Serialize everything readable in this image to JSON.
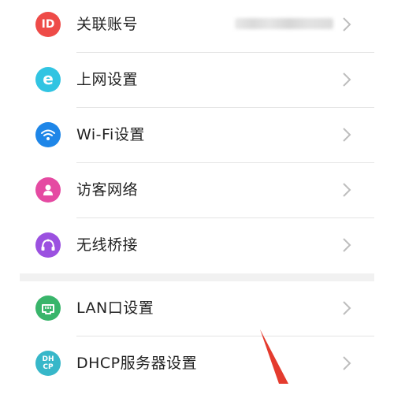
{
  "colors": {
    "account_icon": "#ee4b48",
    "internet_icon": "#31c4e2",
    "wifi_icon": "#1e86e8",
    "guest_icon": "#e54aa2",
    "bridge_icon": "#9b51e0",
    "lan_icon": "#39b56b",
    "dhcp_icon": "#37b7c9",
    "annotation_arrow": "#e43b2e"
  },
  "settings": {
    "account": {
      "icon": "id-icon",
      "icon_text": "ID",
      "label": "关联账号"
    },
    "internet": {
      "icon": "e-icon",
      "icon_text": "e",
      "label": "上网设置"
    },
    "wifi": {
      "icon": "wifi-icon",
      "label": "Wi-Fi设置"
    },
    "guest": {
      "icon": "person-icon",
      "label": "访客网络"
    },
    "bridge": {
      "icon": "wireless-bridge-icon",
      "label": "无线桥接"
    },
    "lan": {
      "icon": "ethernet-port-icon",
      "label": "LAN口设置"
    },
    "dhcp": {
      "icon": "dhcp-icon",
      "icon_text_line1": "DH",
      "icon_text_line2": "CP",
      "label": "DHCP服务器设置"
    }
  }
}
